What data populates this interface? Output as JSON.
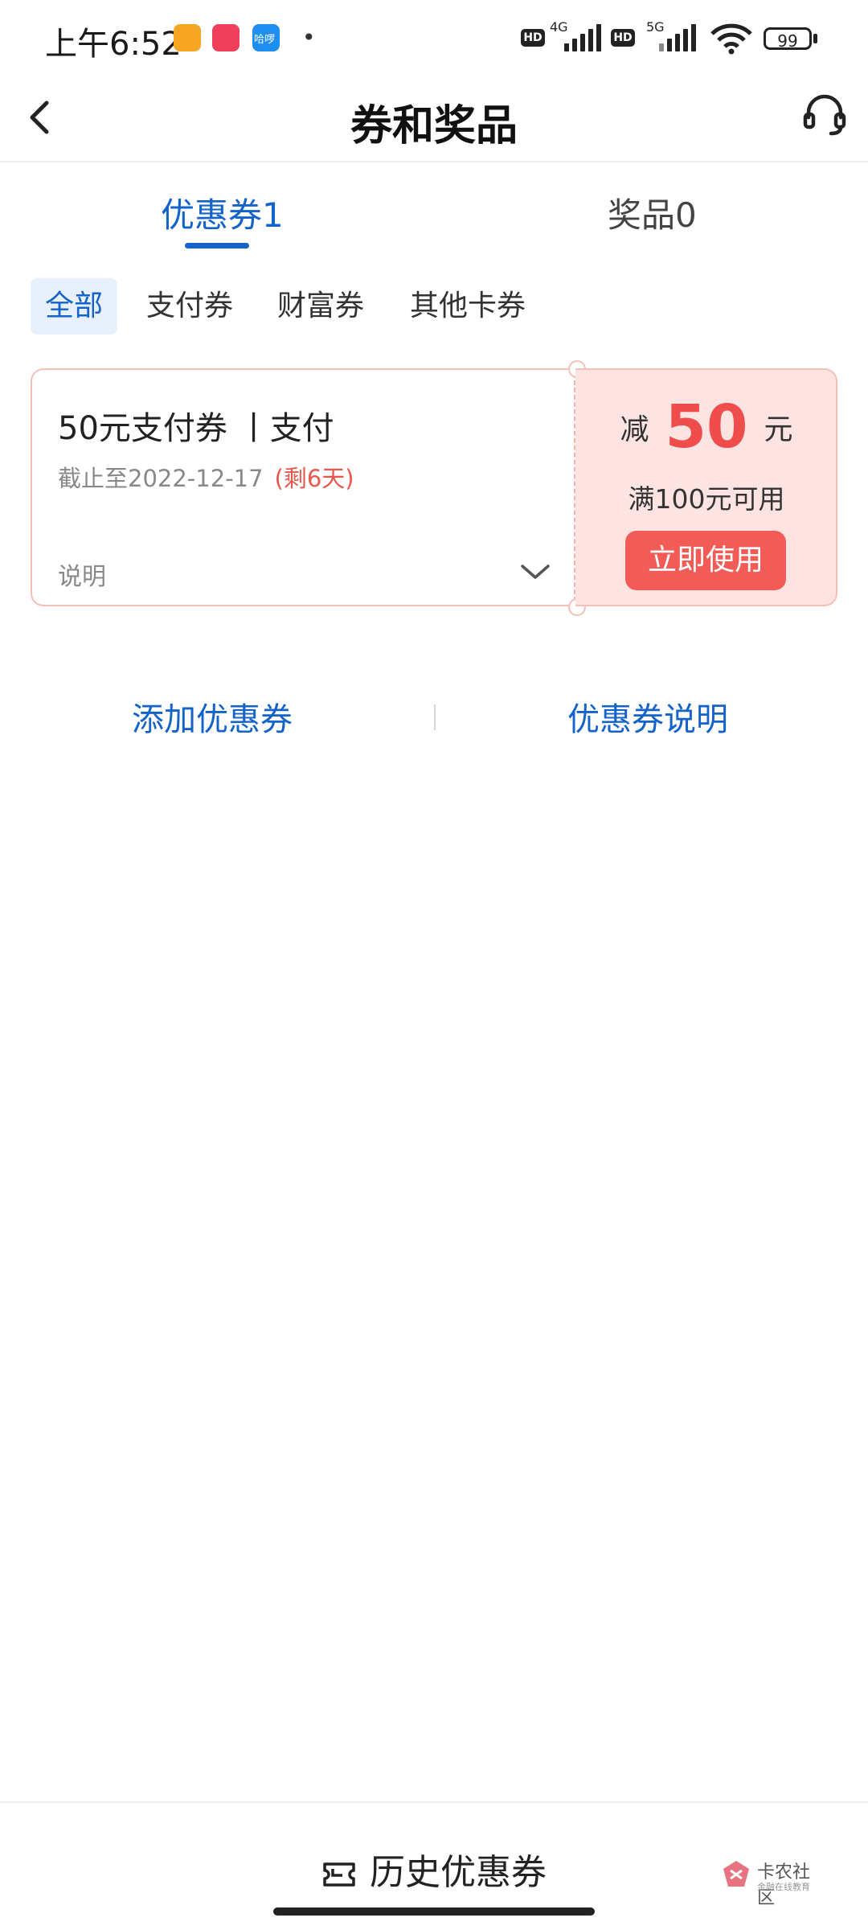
{
  "status_bar": {
    "time": "上午6:52",
    "app3_label": "哈啰",
    "net1": "4G",
    "net2": "5G",
    "hd": "HD",
    "battery": "99"
  },
  "nav": {
    "title": "券和奖品"
  },
  "tabs": [
    {
      "label": "优惠券1",
      "active": true
    },
    {
      "label": "奖品0",
      "active": false
    }
  ],
  "filters": [
    {
      "label": "全部",
      "active": true
    },
    {
      "label": "支付券"
    },
    {
      "label": "财富券"
    },
    {
      "label": "其他卡券"
    }
  ],
  "coupon": {
    "name": "50元支付券 丨支付",
    "expiry": "截止至2022-12-17",
    "remaining": "(剩6天)",
    "note_label": "说明",
    "minus_label": "减",
    "amount": "50",
    "unit": "元",
    "condition": "满100元可用",
    "use_button": "立即使用"
  },
  "links": {
    "add": "添加优惠券",
    "info": "优惠券说明"
  },
  "bottom": {
    "history": "历史优惠券"
  },
  "watermark": {
    "text": "卡农社区",
    "sub": "金融在线教育"
  },
  "colors": {
    "accent_blue": "#1463c8",
    "coupon_red": "#ef4c4c",
    "coupon_bg": "#fde4e2"
  }
}
